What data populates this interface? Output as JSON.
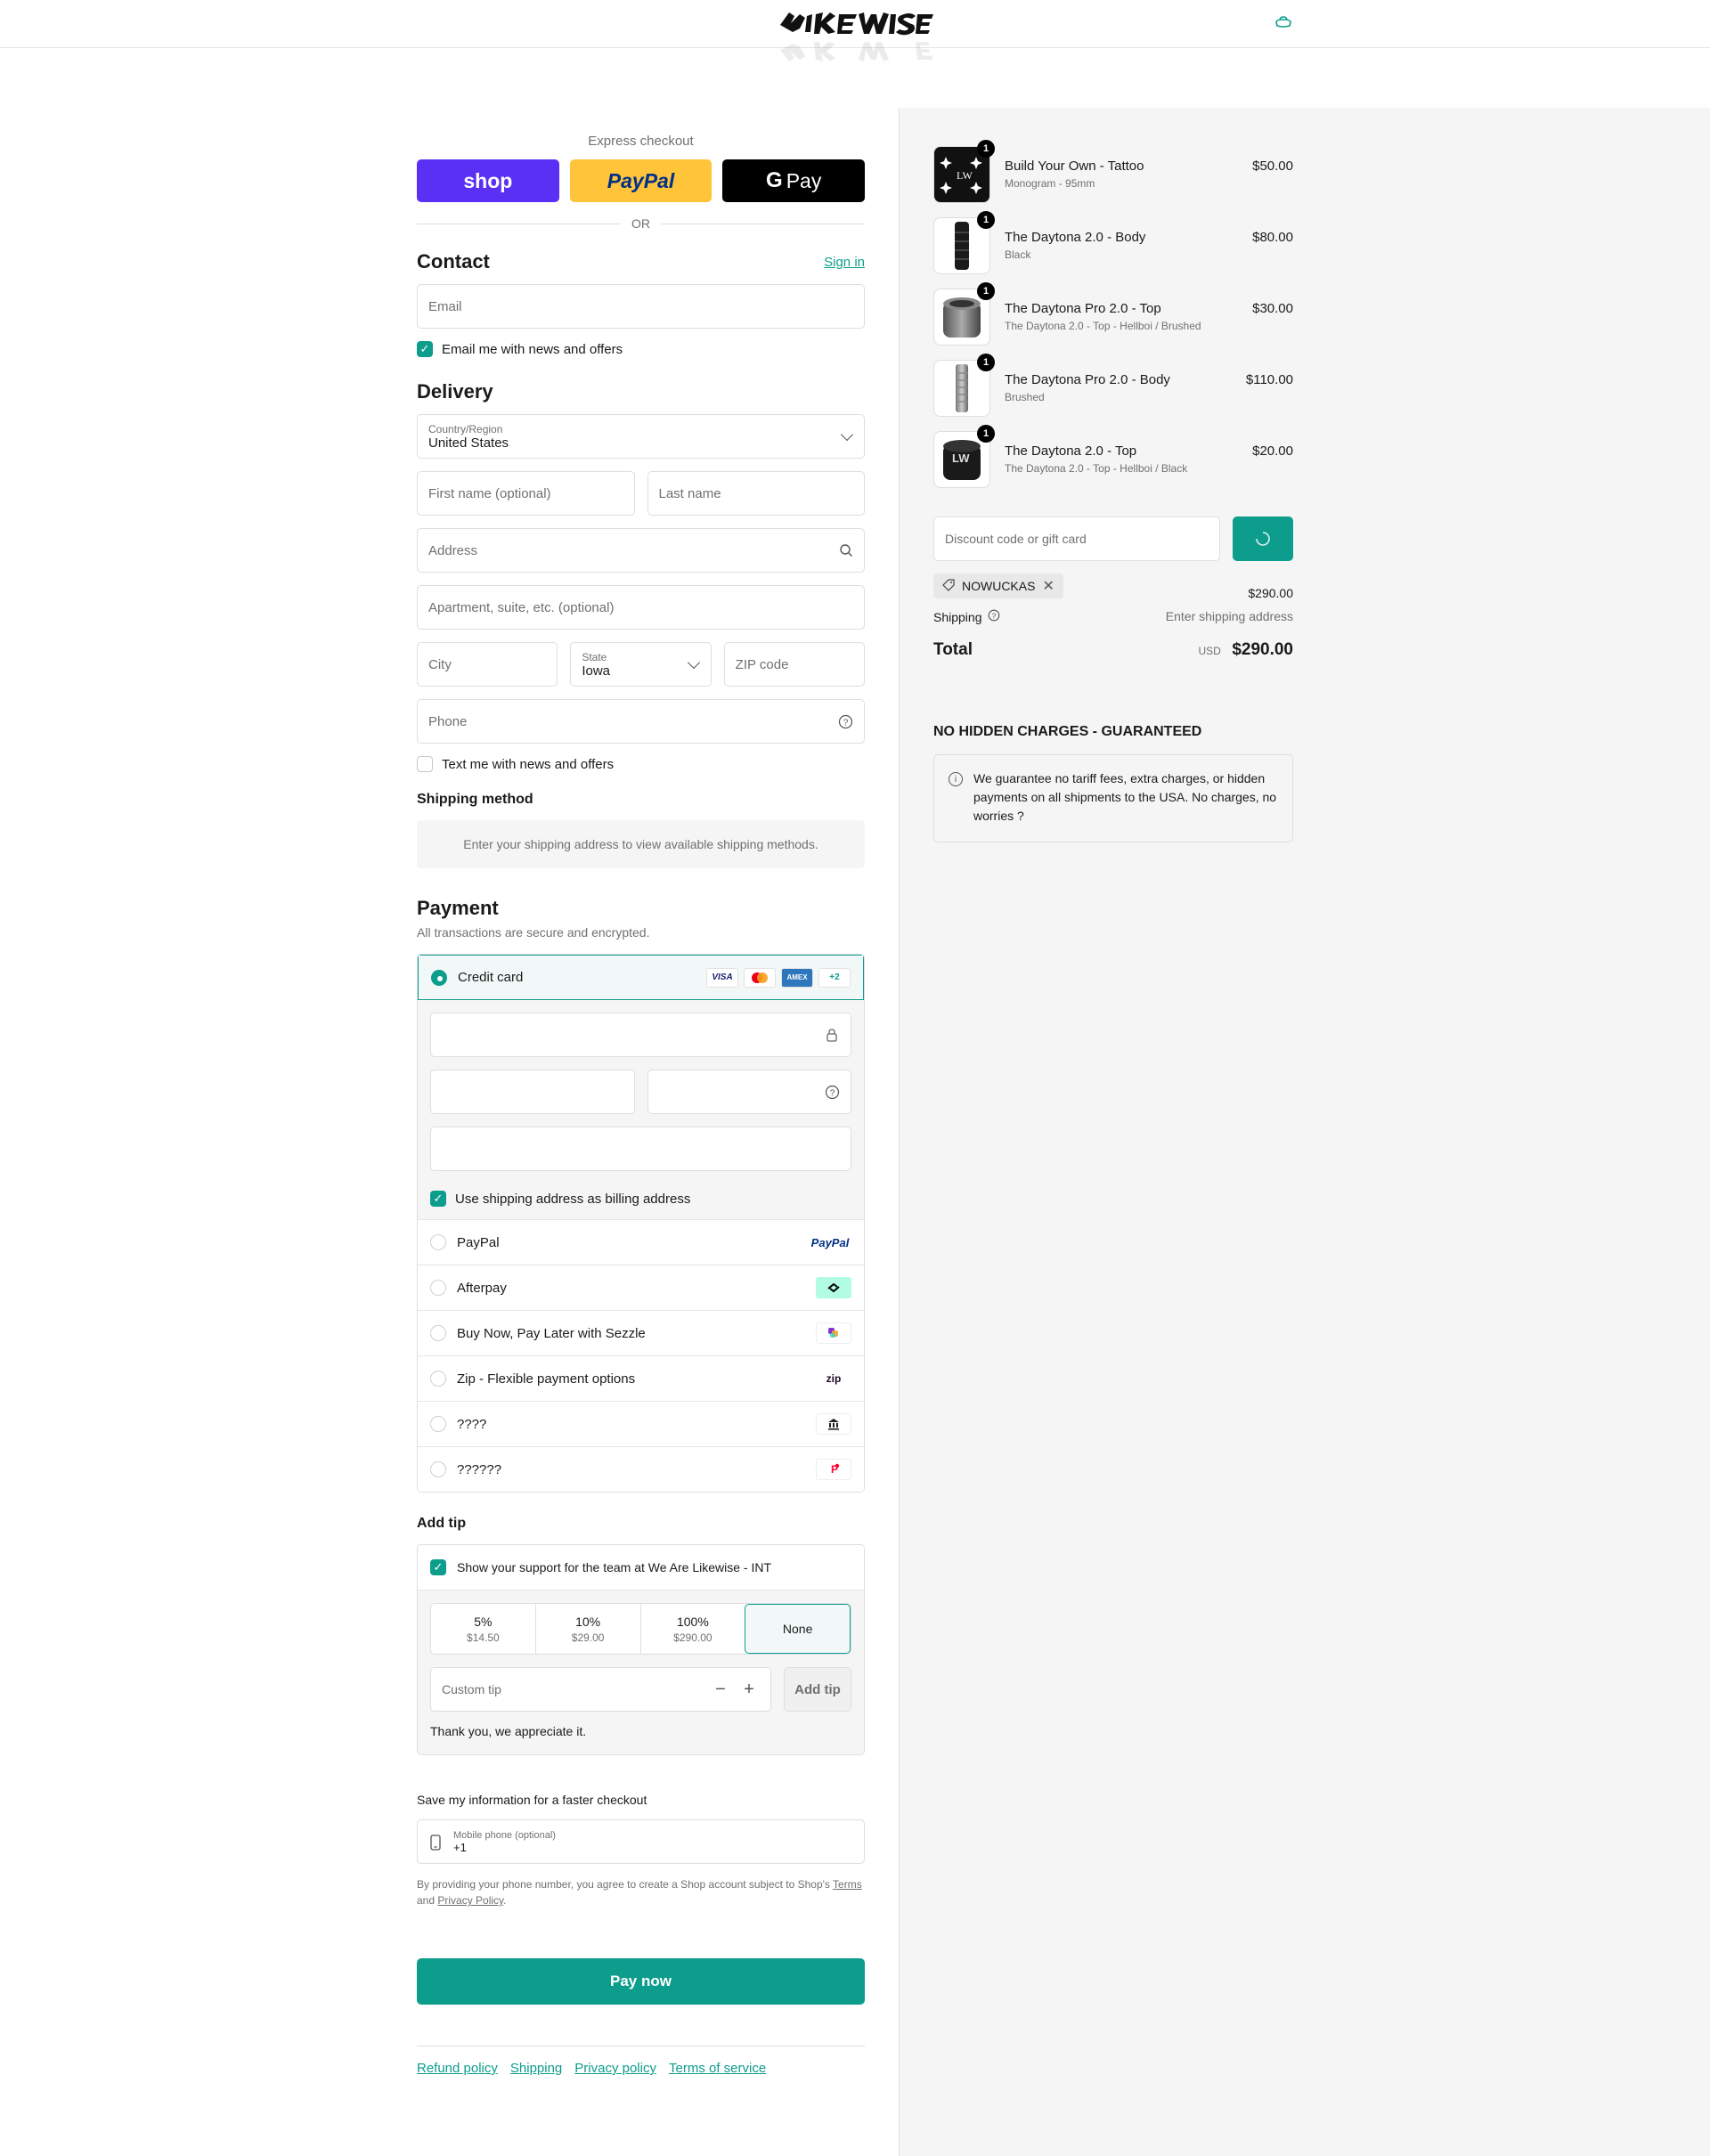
{
  "colors": {
    "accent": "#0d9d8d",
    "shop": "#5a31f4",
    "paypal": "#ffc439",
    "gpay": "#000000"
  },
  "express": {
    "label": "Express checkout",
    "shop_label": "shop",
    "paypal_label": "PayPal",
    "gpay_label": "Pay",
    "or_label": "OR"
  },
  "contact": {
    "title": "Contact",
    "sign_in": "Sign in",
    "email_placeholder": "Email",
    "news_label": "Email me with news and offers"
  },
  "delivery": {
    "title": "Delivery",
    "country_label": "Country/Region",
    "country_value": "United States",
    "first_name": "First name (optional)",
    "last_name": "Last name",
    "address": "Address",
    "apartment": "Apartment, suite, etc. (optional)",
    "city": "City",
    "state_label": "State",
    "state_value": "Iowa",
    "zip": "ZIP code",
    "phone": "Phone",
    "text_label": "Text me with news and offers"
  },
  "shipping_method": {
    "title": "Shipping method",
    "note": "Enter your shipping address to view available shipping methods."
  },
  "payment": {
    "title": "Payment",
    "subtitle": "All transactions are secure and encrypted.",
    "credit_card": "Credit card",
    "card_more": "+2",
    "billing_label": "Use shipping address as billing address",
    "options": [
      {
        "name": "PayPal",
        "logo": "PayPal"
      },
      {
        "name": "Afterpay",
        "logo": "afterpay-logo"
      },
      {
        "name": "Buy Now, Pay Later with Sezzle",
        "logo": "sezzle-logo"
      },
      {
        "name": "Zip - Flexible payment options",
        "logo": "zip"
      },
      {
        "name": "????",
        "logo": "bank-icon"
      },
      {
        "name": "??????",
        "logo": "paypay-logo"
      }
    ]
  },
  "tip": {
    "title": "Add tip",
    "support_label": "Show your support for the team at We Are Likewise - INT",
    "options": [
      {
        "pct": "5%",
        "amt": "$14.50"
      },
      {
        "pct": "10%",
        "amt": "$29.00"
      },
      {
        "pct": "100%",
        "amt": "$290.00"
      },
      {
        "pct": "None",
        "amt": ""
      }
    ],
    "custom_placeholder": "Custom tip",
    "minus": "−",
    "plus": "+",
    "add_button": "Add tip",
    "thanks": "Thank you, we appreciate it."
  },
  "save_info": {
    "title": "Save my information for a faster checkout",
    "mobile_label": "Mobile phone (optional)",
    "mobile_value": "+1",
    "fine_prefix": "By providing your phone number, you agree to create a Shop account subject to Shop's",
    "terms": "Terms",
    "and": "and",
    "privacy": "Privacy Policy",
    "period": "."
  },
  "pay_now": "Pay now",
  "footer": [
    "Refund policy",
    "Shipping",
    "Privacy policy",
    "Terms of service"
  ],
  "cart": {
    "items": [
      {
        "name": "Build Your Own - Tattoo",
        "variant": "Monogram - 95mm",
        "price": "$50.00",
        "qty": "1"
      },
      {
        "name": "The Daytona 2.0 - Body",
        "variant": "Black",
        "price": "$80.00",
        "qty": "1"
      },
      {
        "name": "The Daytona Pro 2.0 - Top",
        "variant": "The Daytona 2.0 - Top - Hellboi / Brushed",
        "price": "$30.00",
        "qty": "1"
      },
      {
        "name": "The Daytona Pro 2.0 - Body",
        "variant": "Brushed",
        "price": "$110.00",
        "qty": "1"
      },
      {
        "name": "The Daytona 2.0 - Top",
        "variant": "The Daytona 2.0 - Top - Hellboi / Black",
        "price": "$20.00",
        "qty": "1"
      }
    ],
    "discount_placeholder": "Discount code or gift card",
    "discount_code": "NOWUCKAS",
    "subtotal": "$290.00",
    "shipping_label": "Shipping",
    "shipping_value": "Enter shipping address",
    "total_label": "Total",
    "currency": "USD",
    "total": "$290.00"
  },
  "guarantee": {
    "title": "NO HIDDEN CHARGES - GUARANTEED",
    "text": "We guarantee no tariff fees, extra charges, or hidden payments on all shipments to the USA. No charges, no worries ?"
  }
}
